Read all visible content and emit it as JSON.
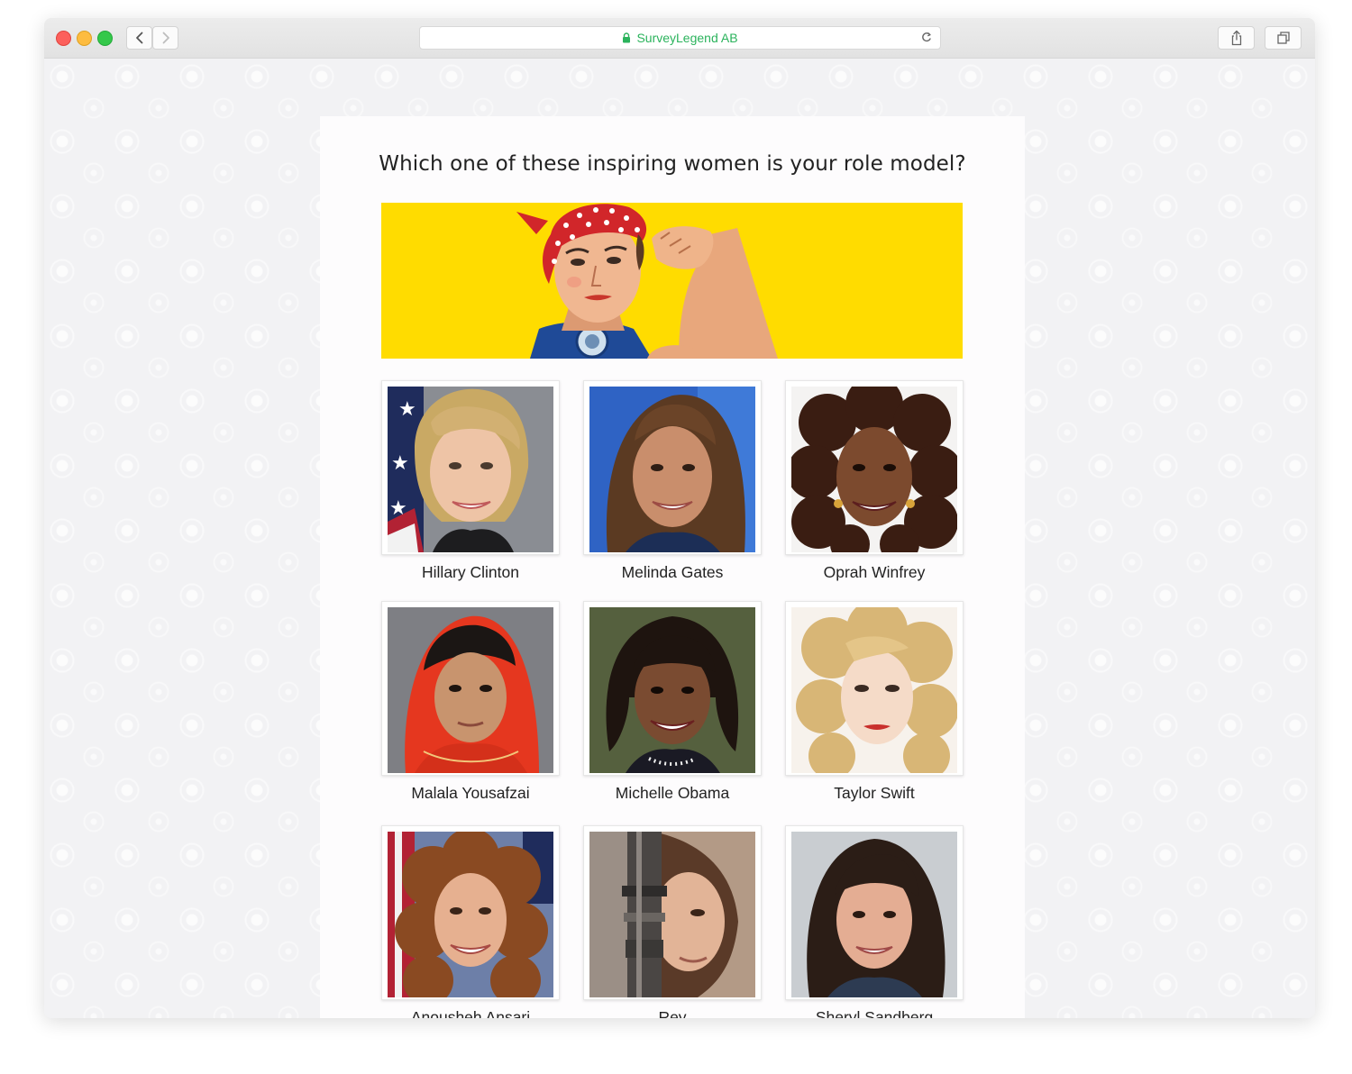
{
  "browser": {
    "site_name": "SurveyLegend AB",
    "icons": {
      "lock": "lock-icon",
      "reload": "reload-icon",
      "back": "chevron-left-icon",
      "forward": "chevron-right-icon",
      "share": "share-icon",
      "tabs": "tabs-icon"
    }
  },
  "survey": {
    "question": "Which one of these inspiring women is your role model?",
    "choices": [
      {
        "label": "Hillary Clinton"
      },
      {
        "label": "Melinda Gates"
      },
      {
        "label": "Oprah Winfrey"
      },
      {
        "label": "Malala Yousafzai"
      },
      {
        "label": "Michelle Obama"
      },
      {
        "label": "Taylor Swift"
      },
      {
        "label": "Anousheh Ansari"
      },
      {
        "label": "Rey"
      },
      {
        "label": "Sheryl Sandberg"
      }
    ]
  },
  "colors": {
    "banner_yellow": "#ffdc00",
    "site_green": "#2bb35c"
  }
}
